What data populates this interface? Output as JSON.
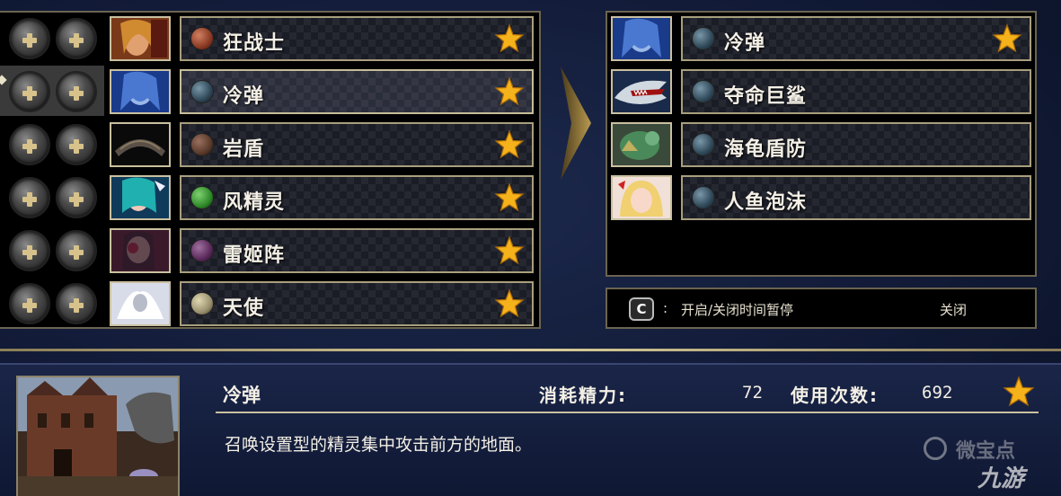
{
  "left_list": {
    "selected_index": 1,
    "rows": [
      {
        "name": "狂战士",
        "orb_color": "#8a3a24",
        "portrait": "berserker-portrait"
      },
      {
        "name": "冷弹",
        "orb_color": "#2f4858",
        "portrait": "cold-bullet-portrait"
      },
      {
        "name": "岩盾",
        "orb_color": "#5a3a2a",
        "portrait": "rock-shield-portrait"
      },
      {
        "name": "风精灵",
        "orb_color": "#2f8a2a",
        "portrait": "wind-spirit-portrait"
      },
      {
        "name": "雷姬阵",
        "orb_color": "#5a2a5a",
        "portrait": "thunder-princess-portrait"
      },
      {
        "name": "天使",
        "orb_color": "#9a9070",
        "portrait": "angel-portrait"
      }
    ]
  },
  "right_list": {
    "rows": [
      {
        "name": "冷弹",
        "orb_color": "#2f4858",
        "portrait": "cold-bullet-portrait",
        "star": true
      },
      {
        "name": "夺命巨鲨",
        "orb_color": "#2f4858",
        "portrait": "shark-portrait",
        "star": false
      },
      {
        "name": "海龟盾防",
        "orb_color": "#2f4858",
        "portrait": "turtle-portrait",
        "star": false
      },
      {
        "name": "人鱼泡沫",
        "orb_color": "#2f4858",
        "portrait": "mermaid-portrait",
        "star": false
      }
    ]
  },
  "help": {
    "key": "C",
    "colon": ":",
    "text": "开启/关闭时间暂停",
    "state": "关闭"
  },
  "detail": {
    "skill_name": "冷弹",
    "cost_label": "消耗精力:",
    "cost_value": "72",
    "uses_label": "使用次数:",
    "uses_value": "692",
    "description": "召唤设置型的精灵集中攻击前方的地面。"
  },
  "watermarks": {
    "partial": "微宝点",
    "site": "九游"
  },
  "colors": {
    "star_fill": "#f6b21a",
    "frame_gold": "#a89f7d",
    "bg_navy": "#121b38"
  }
}
